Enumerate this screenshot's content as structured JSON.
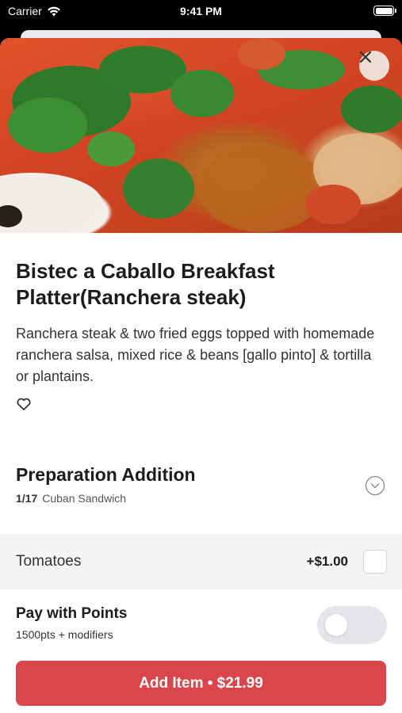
{
  "status_bar": {
    "carrier": "Carrier",
    "time": "9:41 PM"
  },
  "item": {
    "title": "Bistec a Caballo Breakfast Platter(Ranchera steak)",
    "description": "Ranchera steak & two fried eggs topped with homemade ranchera salsa, mixed rice & beans [gallo pinto] & tortilla or plantains.",
    "favorite_icon": "heart-icon"
  },
  "modifier_group": {
    "title": "Preparation Addition",
    "count": "1/17",
    "subtitle": "Cuban Sandwich",
    "options": [
      {
        "label": "Tomatoes",
        "price": "+$1.00",
        "selected": false
      }
    ]
  },
  "points": {
    "title": "Pay with Points",
    "subtitle": "1500pts + modifiers",
    "enabled": false
  },
  "add_button": {
    "label": "Add Item • $21.99"
  },
  "colors": {
    "accent": "#d9464b",
    "toggle_off": "#e5e5ea",
    "option_row_bg": "#f4f4f5"
  }
}
